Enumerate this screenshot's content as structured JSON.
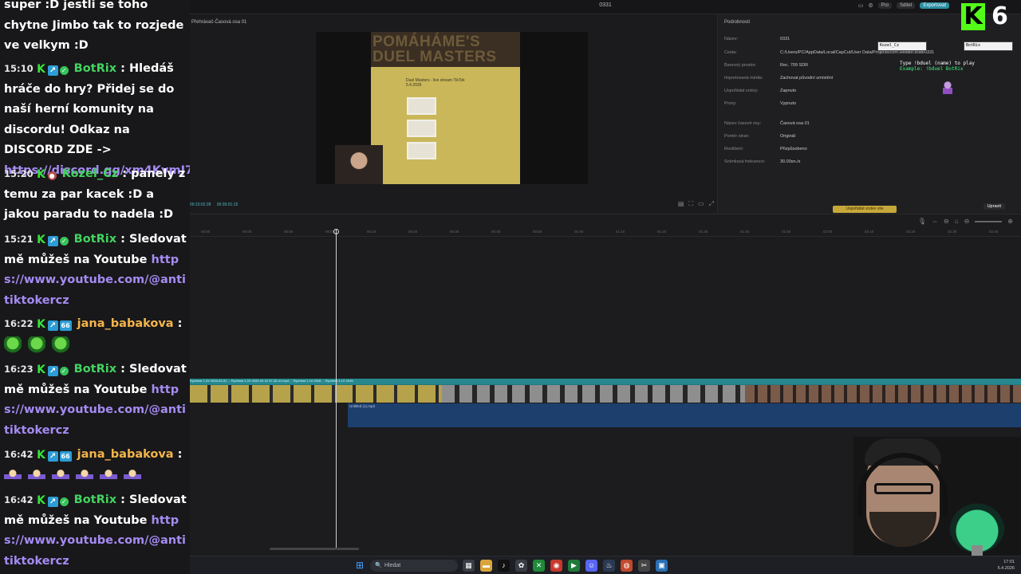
{
  "editor": {
    "window_title": "0331",
    "top_pills": [
      "Pro",
      "Sdílet",
      "Exportovat"
    ],
    "player": {
      "title": "Přehrávač-Časová osa 01",
      "current_time": "00:10:02:28",
      "total_time": "00:39:01:15",
      "video_text_line1": "Duel Masters - live stream TikTok",
      "video_text_line2": "5.4.2026",
      "video_banner": "POMÁHÁME'S DUEL MASTERS"
    },
    "details": {
      "title": "Podrobnosti",
      "rows": [
        {
          "label": "Název:",
          "value": "0331"
        },
        {
          "label": "Cesta:",
          "value": "C:/Users/PC/AppData/Local/CapCut/User Data/Projects/com.lveditor.draft/0331"
        },
        {
          "label": "Barevný prostor:",
          "value": "Rec. 709 SDR"
        },
        {
          "label": "Importovaná média:",
          "value": "Zachovat původní umístění"
        },
        {
          "label": "Uspořádat vrstvy:",
          "value": "Zapnuto"
        },
        {
          "label": "Proxy:",
          "value": "Vypnuto"
        },
        {
          "label": "Název časové osy:",
          "value": "Časová osa 01"
        },
        {
          "label": "Poměr stran:",
          "value": "Originál"
        },
        {
          "label": "Rozlišení:",
          "value": "Přizpůsobeno"
        },
        {
          "label": "Snímková frekvence:",
          "value": "30.00sn./s"
        }
      ],
      "edit_button": "Upravit",
      "yellow_button": "Uspořádat vrstev vše"
    },
    "timeline": {
      "ruler": [
        "00:50",
        "00:00",
        "00:50",
        "00:00",
        "00:10",
        "00:20",
        "00:30",
        "00:40",
        "00:50",
        "01:00",
        "01:10",
        "01:20",
        "01:30",
        "01:40",
        "01:50",
        "02:00",
        "02:10",
        "02:20",
        "02:30",
        "02:40"
      ],
      "video_track_label": "Rychlost 1.2X 2026-03-31 ... Rychlost 1.2X 2026-03-31 07-26-41.mp4 ... Rychlost 1.1X 2026 ... Rychlost 1.1X 2026",
      "audio_track_label": "Untitled (1).mp3"
    },
    "taskbar": {
      "search_placeholder": "Hledat",
      "clock_time": "17:01",
      "clock_date": "5.4.2026"
    }
  },
  "chat": {
    "messages": [
      {
        "id": "m0",
        "time": "",
        "user": "",
        "text": "super :D jestli se toho chytne Jimbo tak to rozjede ve velkym :D",
        "link": ""
      },
      {
        "id": "m1",
        "time": "15:10",
        "user": "BotRix",
        "text": "Hledáš hráče do hry? Přidej se do naší herní komunity na discordu! Odkaz na DISCORD ZDE ->",
        "link": "https://discord.gg/xm4KvmJ7"
      },
      {
        "id": "m2",
        "time": "15:20",
        "user": "Kozel_Cz",
        "text": "panely z temu za par kacek :D a jakou paradu to nadela :D",
        "link": ""
      },
      {
        "id": "m3",
        "time": "15:21",
        "user": "BotRix",
        "text": "Sledovat mě můžeš na Youtube",
        "link": "https://www.youtube.com/@antitiktokercz"
      },
      {
        "id": "m4",
        "time": "16:22",
        "user": "jana_babakova",
        "text": "",
        "link": ""
      },
      {
        "id": "m5",
        "time": "16:23",
        "user": "BotRix",
        "text": "Sledovat mě můžeš na Youtube",
        "link": "https://www.youtube.com/@antitiktokercz"
      },
      {
        "id": "m6",
        "time": "16:42",
        "user": "jana_babakova",
        "text": "",
        "link": ""
      },
      {
        "id": "m7",
        "time": "16:42",
        "user": "BotRix",
        "text": "Sledovat mě můžeš na Youtube",
        "link": "https://www.youtube.com/@antitiktokercz"
      }
    ]
  },
  "overlay": {
    "viewer_count": "6",
    "kick_logo": "K",
    "duel_card_left": "Kozel_Cz",
    "duel_card_right": "BotRix",
    "duel_prompt": "Type !bduel (name) to play",
    "duel_example": "Example: !bduel BotRix"
  },
  "colors": {
    "kick_green": "#53fc18",
    "username_green": "#43d35f",
    "username_orange": "#f4b44a",
    "link_purple": "#a58bf3",
    "timeline_video": "#1f7a80",
    "timeline_audio": "#1d3f6e"
  },
  "icons": [
    "search-icon",
    "windows-start-icon",
    "kick-badge-icon",
    "verified-badge-icon",
    "moderator-badge-icon",
    "playhead-icon"
  ]
}
